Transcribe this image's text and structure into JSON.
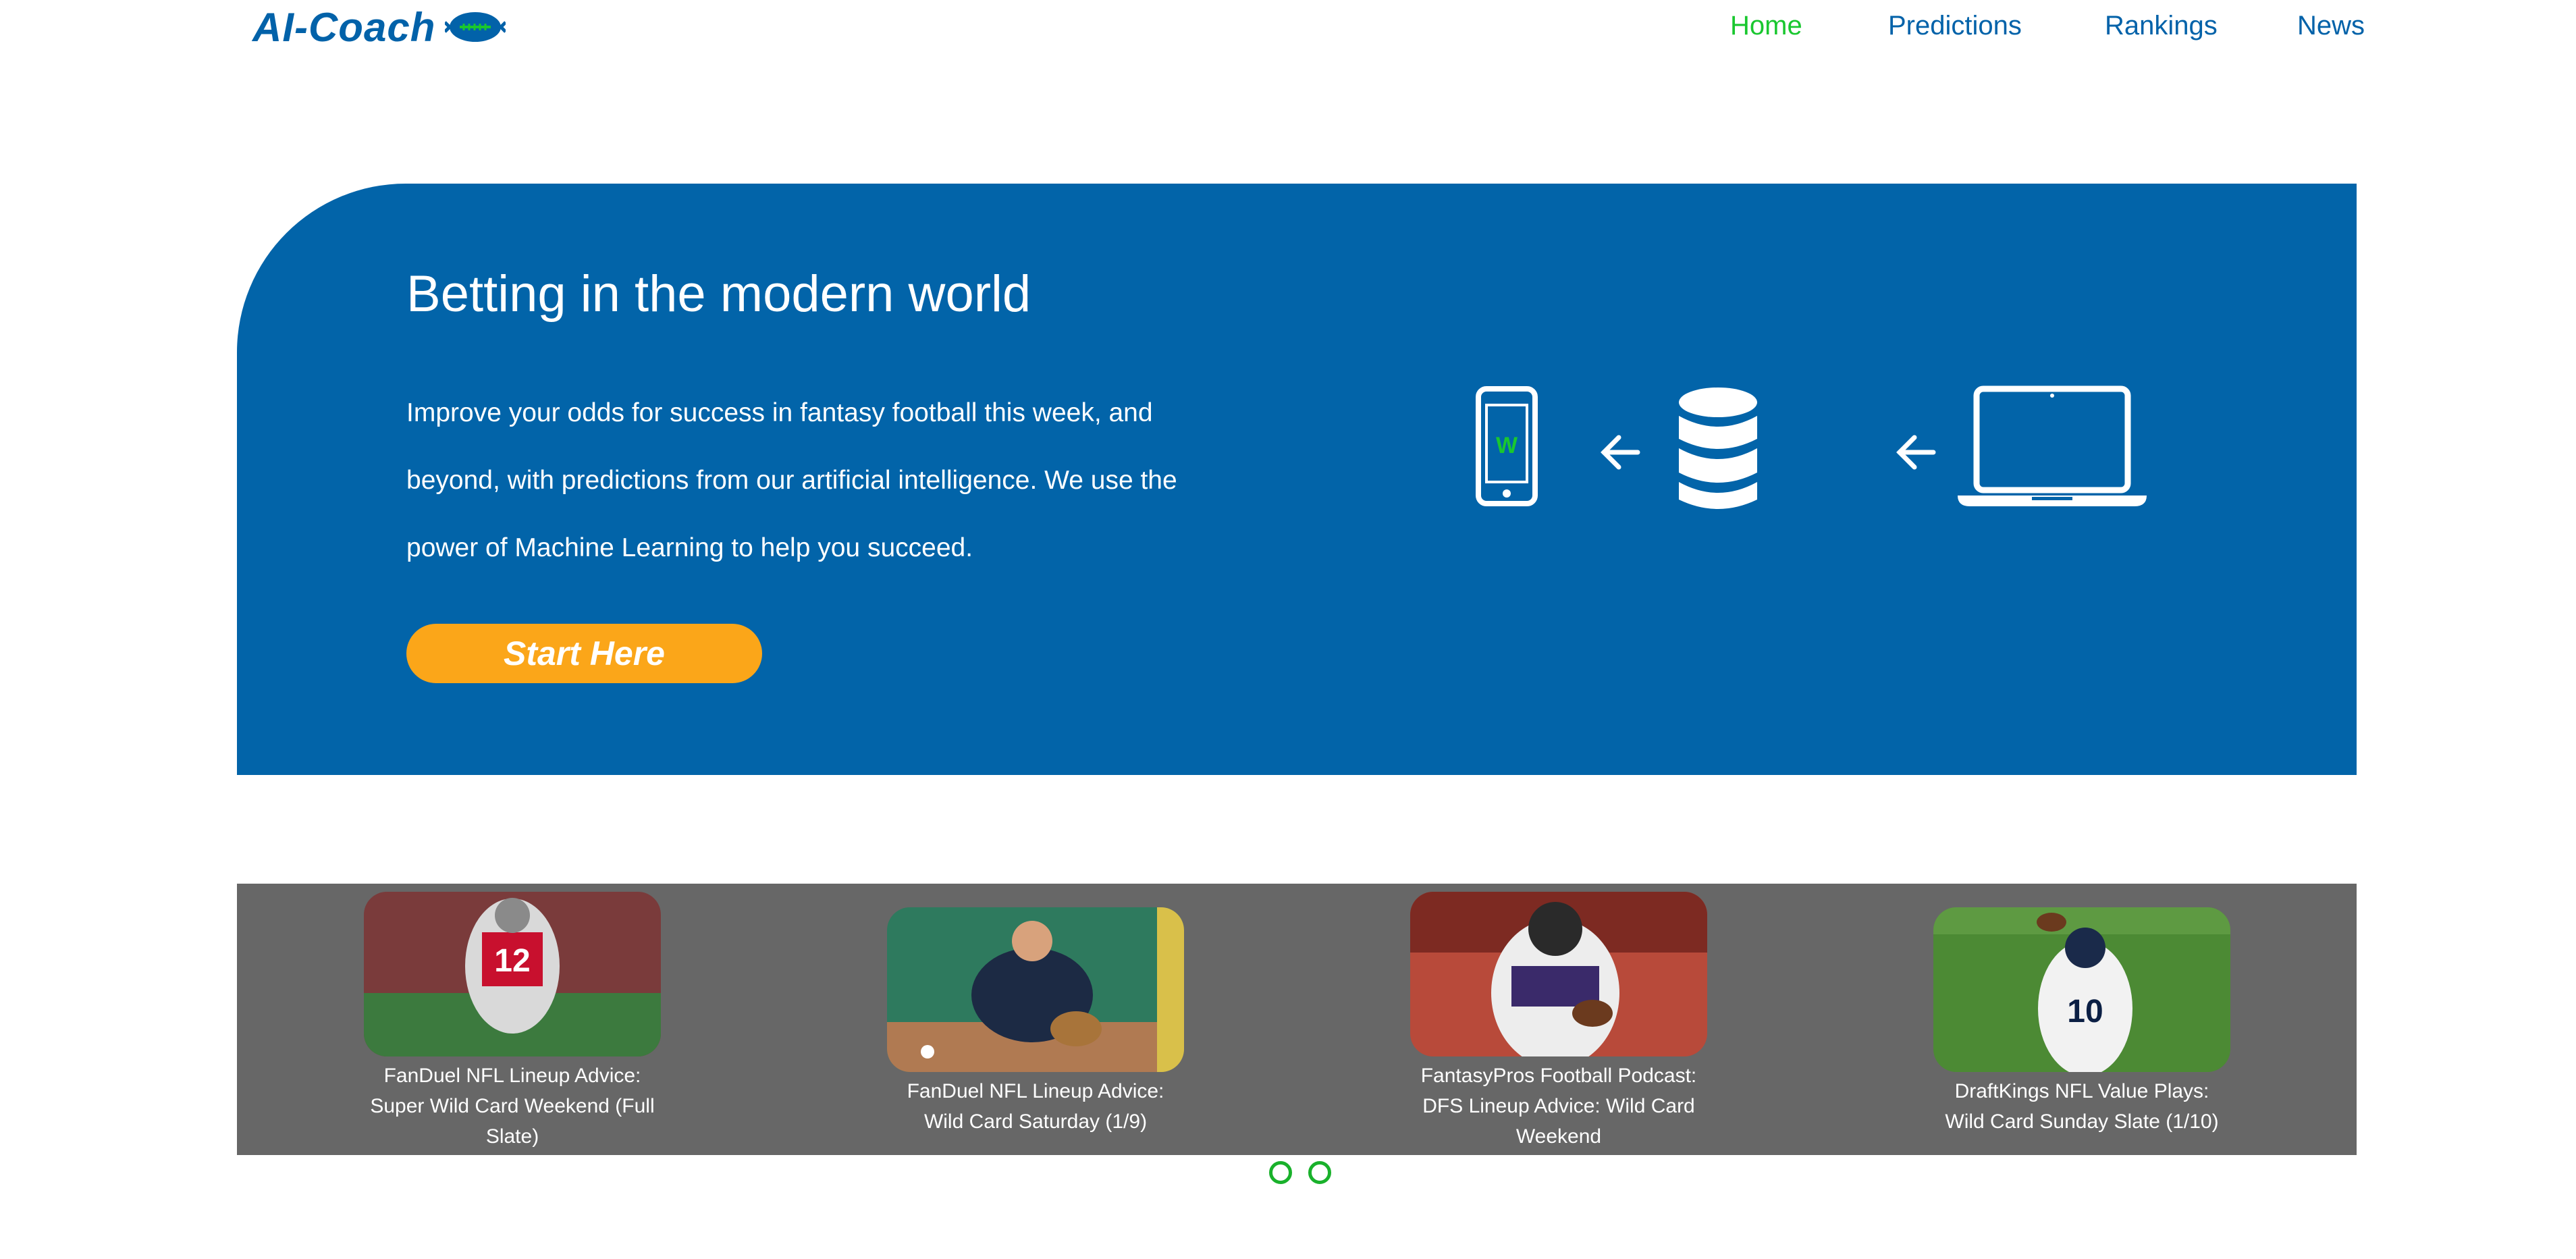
{
  "brand": {
    "name": "AI-Coach",
    "logo_icon": "football-icon",
    "color": "#0262a9"
  },
  "nav": {
    "items": [
      {
        "label": "Home",
        "active": true
      },
      {
        "label": "Predictions",
        "active": false
      },
      {
        "label": "Rankings",
        "active": false
      },
      {
        "label": "News",
        "active": false
      }
    ],
    "active_color": "#19c72f"
  },
  "hero": {
    "title": "Betting in the modern world",
    "description": "Improve your odds for success in fantasy football this week, and beyond, with predictions from our artificial intelligence. We use the power of Machine Learning to help you succeed.",
    "cta_label": "Start Here",
    "background_color": "#0264a9",
    "cta_color": "#fba619",
    "graphic": {
      "phone_screen_letter": "W",
      "icons": [
        "phone-icon",
        "arrow-left-icon",
        "database-icon",
        "arrow-left-icon",
        "laptop-icon"
      ]
    }
  },
  "news": {
    "background_color": "#676767",
    "cards": [
      {
        "caption": "FanDuel NFL Lineup Advice: Super Wild Card Weekend (Full Slate)",
        "image": "football-player-running-photo"
      },
      {
        "caption": "FanDuel NFL Lineup Advice: Wild Card Saturday (1/9)",
        "image": "baseball-player-fielding-photo"
      },
      {
        "caption": "FantasyPros Football Podcast: DFS Lineup Advice: Wild Card Weekend",
        "image": "football-player-carrying-ball-photo"
      },
      {
        "caption": "DraftKings NFL Value Plays: Wild Card Sunday Slate (1/10)",
        "image": "quarterback-throwing-photo"
      }
    ],
    "pagination": {
      "pages": 2
    }
  }
}
